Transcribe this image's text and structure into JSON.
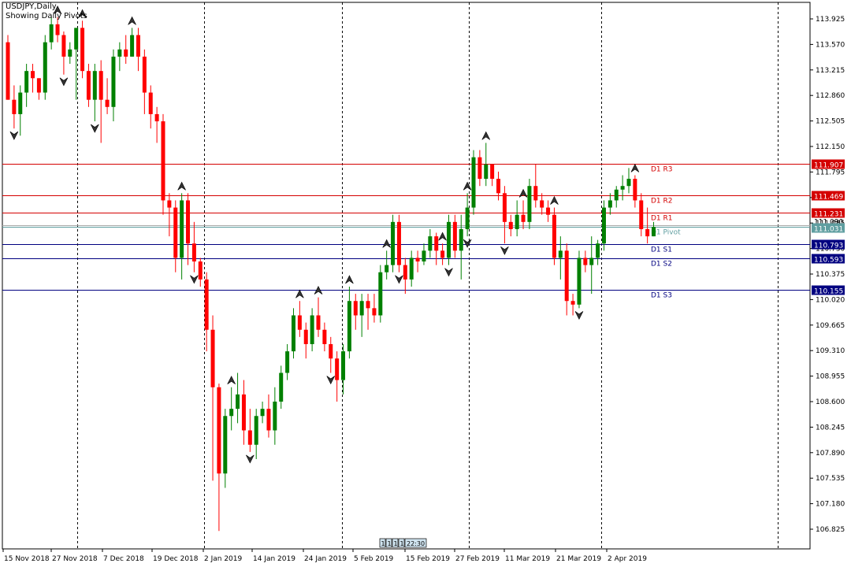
{
  "header": {
    "symbol_title": "USDJPY,Daily",
    "indicator_note": "Showing Daily Pivots"
  },
  "colors": {
    "bull": "#008000",
    "bear": "#ff0000",
    "resistance_line": "#d40000",
    "support_line": "#000080",
    "pivot_line": "#5f9ea0",
    "current_price_line": "#a9a9a9",
    "grid": "#000000",
    "background": "#ffffff"
  },
  "chart_data": {
    "type": "candlestick",
    "symbol": "USDJPY",
    "timeframe": "Daily",
    "ylim": [
      106.5,
      114.1
    ],
    "y_ticks": [
      "113.925",
      "113.570",
      "113.215",
      "112.860",
      "112.505",
      "112.150",
      "111.795",
      "111.440",
      "111.085",
      "110.730",
      "110.375",
      "110.020",
      "109.665",
      "109.310",
      "108.955",
      "108.600",
      "108.245",
      "107.890",
      "107.535",
      "107.180",
      "106.825"
    ],
    "x_tick_labels": [
      "15 Nov 2018",
      "27 Nov 2018",
      "7 Dec 2018",
      "19 Dec 2018",
      "2 Jan 2019",
      "14 Jan 2019",
      "24 Jan 2019",
      "5 Feb 2019",
      "15 Feb 2019",
      "27 Feb 2019",
      "11 Mar 2019",
      "21 Mar 2019",
      "2 Apr 2019"
    ],
    "grid": "vertical dashed separators",
    "candles": [
      {
        "o": 113.6,
        "h": 113.7,
        "l": 112.8,
        "c": 112.8
      },
      {
        "o": 112.8,
        "h": 113.0,
        "l": 112.4,
        "c": 112.6
      },
      {
        "o": 112.6,
        "h": 113.0,
        "l": 112.3,
        "c": 112.9
      },
      {
        "o": 112.9,
        "h": 113.3,
        "l": 112.7,
        "c": 113.2
      },
      {
        "o": 113.2,
        "h": 113.3,
        "l": 112.9,
        "c": 113.1
      },
      {
        "o": 113.1,
        "h": 113.1,
        "l": 112.8,
        "c": 112.9
      },
      {
        "o": 112.9,
        "h": 113.7,
        "l": 112.8,
        "c": 113.6
      },
      {
        "o": 113.6,
        "h": 113.95,
        "l": 113.5,
        "c": 113.85
      },
      {
        "o": 113.85,
        "h": 113.95,
        "l": 113.6,
        "c": 113.7
      },
      {
        "o": 113.7,
        "h": 113.75,
        "l": 113.15,
        "c": 113.4
      },
      {
        "o": 113.4,
        "h": 113.6,
        "l": 113.3,
        "c": 113.5
      },
      {
        "o": 113.5,
        "h": 113.8,
        "l": 112.8,
        "c": 113.8
      },
      {
        "o": 113.8,
        "h": 113.9,
        "l": 113.1,
        "c": 113.2
      },
      {
        "o": 113.2,
        "h": 113.3,
        "l": 112.7,
        "c": 112.8
      },
      {
        "o": 112.8,
        "h": 113.3,
        "l": 112.5,
        "c": 113.2
      },
      {
        "o": 113.2,
        "h": 113.35,
        "l": 112.2,
        "c": 112.8
      },
      {
        "o": 112.8,
        "h": 113.1,
        "l": 112.6,
        "c": 112.7
      },
      {
        "o": 112.7,
        "h": 113.5,
        "l": 112.5,
        "c": 113.4
      },
      {
        "o": 113.4,
        "h": 113.6,
        "l": 113.2,
        "c": 113.5
      },
      {
        "o": 113.5,
        "h": 113.7,
        "l": 113.3,
        "c": 113.4
      },
      {
        "o": 113.4,
        "h": 113.8,
        "l": 113.4,
        "c": 113.7
      },
      {
        "o": 113.7,
        "h": 113.8,
        "l": 113.2,
        "c": 113.4
      },
      {
        "o": 113.4,
        "h": 113.5,
        "l": 112.6,
        "c": 112.9
      },
      {
        "o": 112.9,
        "h": 113.0,
        "l": 112.4,
        "c": 112.6
      },
      {
        "o": 112.6,
        "h": 112.7,
        "l": 112.2,
        "c": 112.5
      },
      {
        "o": 112.5,
        "h": 112.6,
        "l": 111.2,
        "c": 111.4
      },
      {
        "o": 111.4,
        "h": 111.5,
        "l": 110.9,
        "c": 111.3
      },
      {
        "o": 111.3,
        "h": 111.4,
        "l": 110.4,
        "c": 110.6
      },
      {
        "o": 110.6,
        "h": 111.5,
        "l": 110.3,
        "c": 111.4
      },
      {
        "o": 111.4,
        "h": 111.5,
        "l": 110.5,
        "c": 110.8
      },
      {
        "o": 110.8,
        "h": 111.1,
        "l": 110.4,
        "c": 110.55
      },
      {
        "o": 110.55,
        "h": 110.6,
        "l": 110.2,
        "c": 110.3
      },
      {
        "o": 110.3,
        "h": 110.4,
        "l": 109.3,
        "c": 109.6
      },
      {
        "o": 109.6,
        "h": 109.8,
        "l": 107.5,
        "c": 108.8
      },
      {
        "o": 108.8,
        "h": 108.85,
        "l": 106.8,
        "c": 107.6
      },
      {
        "o": 107.6,
        "h": 108.5,
        "l": 107.4,
        "c": 108.4
      },
      {
        "o": 108.4,
        "h": 108.8,
        "l": 108.2,
        "c": 108.5
      },
      {
        "o": 108.5,
        "h": 109.0,
        "l": 108.3,
        "c": 108.7
      },
      {
        "o": 108.7,
        "h": 108.9,
        "l": 108.0,
        "c": 108.2
      },
      {
        "o": 108.2,
        "h": 108.5,
        "l": 107.9,
        "c": 108.0
      },
      {
        "o": 108.0,
        "h": 108.5,
        "l": 107.8,
        "c": 108.4
      },
      {
        "o": 108.4,
        "h": 108.6,
        "l": 108.3,
        "c": 108.5
      },
      {
        "o": 108.5,
        "h": 108.7,
        "l": 108.1,
        "c": 108.2
      },
      {
        "o": 108.2,
        "h": 108.8,
        "l": 108.0,
        "c": 108.6
      },
      {
        "o": 108.6,
        "h": 109.1,
        "l": 108.5,
        "c": 109.0
      },
      {
        "o": 109.0,
        "h": 109.4,
        "l": 108.9,
        "c": 109.3
      },
      {
        "o": 109.3,
        "h": 109.9,
        "l": 109.2,
        "c": 109.8
      },
      {
        "o": 109.8,
        "h": 110.0,
        "l": 109.5,
        "c": 109.6
      },
      {
        "o": 109.6,
        "h": 109.7,
        "l": 109.2,
        "c": 109.4
      },
      {
        "o": 109.4,
        "h": 109.9,
        "l": 109.3,
        "c": 109.8
      },
      {
        "o": 109.8,
        "h": 110.05,
        "l": 109.5,
        "c": 109.6
      },
      {
        "o": 109.6,
        "h": 109.7,
        "l": 109.3,
        "c": 109.4
      },
      {
        "o": 109.4,
        "h": 109.5,
        "l": 109.0,
        "c": 109.2
      },
      {
        "o": 109.2,
        "h": 109.3,
        "l": 108.6,
        "c": 108.9
      },
      {
        "o": 108.9,
        "h": 109.4,
        "l": 108.7,
        "c": 109.3
      },
      {
        "o": 109.3,
        "h": 110.2,
        "l": 109.2,
        "c": 110.0
      },
      {
        "o": 110.0,
        "h": 110.1,
        "l": 109.6,
        "c": 109.8
      },
      {
        "o": 109.8,
        "h": 110.1,
        "l": 109.5,
        "c": 110.0
      },
      {
        "o": 110.0,
        "h": 110.1,
        "l": 109.6,
        "c": 109.9
      },
      {
        "o": 109.9,
        "h": 110.1,
        "l": 109.7,
        "c": 109.8
      },
      {
        "o": 109.8,
        "h": 110.5,
        "l": 109.7,
        "c": 110.4
      },
      {
        "o": 110.4,
        "h": 110.7,
        "l": 110.3,
        "c": 110.5
      },
      {
        "o": 110.5,
        "h": 111.2,
        "l": 110.4,
        "c": 111.1
      },
      {
        "o": 111.1,
        "h": 111.2,
        "l": 110.4,
        "c": 110.5
      },
      {
        "o": 110.5,
        "h": 110.6,
        "l": 110.1,
        "c": 110.3
      },
      {
        "o": 110.3,
        "h": 110.7,
        "l": 110.2,
        "c": 110.6
      },
      {
        "o": 110.6,
        "h": 110.7,
        "l": 110.4,
        "c": 110.55
      },
      {
        "o": 110.55,
        "h": 110.8,
        "l": 110.5,
        "c": 110.7
      },
      {
        "o": 110.7,
        "h": 111.0,
        "l": 110.6,
        "c": 110.9
      },
      {
        "o": 110.9,
        "h": 110.95,
        "l": 110.5,
        "c": 110.7
      },
      {
        "o": 110.7,
        "h": 110.8,
        "l": 110.5,
        "c": 110.6
      },
      {
        "o": 110.6,
        "h": 111.2,
        "l": 110.5,
        "c": 111.1
      },
      {
        "o": 111.1,
        "h": 111.2,
        "l": 110.6,
        "c": 110.7
      },
      {
        "o": 110.7,
        "h": 111.2,
        "l": 110.3,
        "c": 111.0
      },
      {
        "o": 111.0,
        "h": 111.5,
        "l": 110.9,
        "c": 111.3
      },
      {
        "o": 111.3,
        "h": 112.1,
        "l": 111.2,
        "c": 112.0
      },
      {
        "o": 112.0,
        "h": 112.1,
        "l": 111.6,
        "c": 111.7
      },
      {
        "o": 111.7,
        "h": 112.2,
        "l": 111.6,
        "c": 111.9
      },
      {
        "o": 111.9,
        "h": 111.9,
        "l": 111.6,
        "c": 111.7
      },
      {
        "o": 111.7,
        "h": 111.8,
        "l": 111.4,
        "c": 111.5
      },
      {
        "o": 111.5,
        "h": 111.6,
        "l": 110.8,
        "c": 111.1
      },
      {
        "o": 111.1,
        "h": 111.2,
        "l": 110.9,
        "c": 111.0
      },
      {
        "o": 111.0,
        "h": 111.4,
        "l": 110.9,
        "c": 111.2
      },
      {
        "o": 111.2,
        "h": 111.4,
        "l": 111.0,
        "c": 111.1
      },
      {
        "o": 111.1,
        "h": 111.7,
        "l": 111.0,
        "c": 111.6
      },
      {
        "o": 111.6,
        "h": 111.9,
        "l": 111.3,
        "c": 111.4
      },
      {
        "o": 111.4,
        "h": 111.5,
        "l": 111.2,
        "c": 111.3
      },
      {
        "o": 111.3,
        "h": 111.4,
        "l": 111.1,
        "c": 111.2
      },
      {
        "o": 111.2,
        "h": 111.3,
        "l": 110.5,
        "c": 110.6
      },
      {
        "o": 110.6,
        "h": 110.9,
        "l": 110.3,
        "c": 110.7
      },
      {
        "o": 110.7,
        "h": 110.8,
        "l": 109.8,
        "c": 110.0
      },
      {
        "o": 110.0,
        "h": 110.1,
        "l": 109.8,
        "c": 109.95
      },
      {
        "o": 109.95,
        "h": 110.7,
        "l": 109.9,
        "c": 110.6
      },
      {
        "o": 110.6,
        "h": 110.7,
        "l": 110.4,
        "c": 110.5
      },
      {
        "o": 110.5,
        "h": 110.9,
        "l": 110.1,
        "c": 110.6
      },
      {
        "o": 110.6,
        "h": 110.85,
        "l": 110.5,
        "c": 110.8
      },
      {
        "o": 110.8,
        "h": 111.4,
        "l": 110.7,
        "c": 111.3
      },
      {
        "o": 111.3,
        "h": 111.5,
        "l": 111.2,
        "c": 111.4
      },
      {
        "o": 111.4,
        "h": 111.6,
        "l": 111.3,
        "c": 111.55
      },
      {
        "o": 111.55,
        "h": 111.75,
        "l": 111.4,
        "c": 111.6
      },
      {
        "o": 111.6,
        "h": 111.85,
        "l": 111.5,
        "c": 111.7
      },
      {
        "o": 111.7,
        "h": 111.75,
        "l": 111.3,
        "c": 111.4
      },
      {
        "o": 111.4,
        "h": 111.5,
        "l": 110.9,
        "c": 111.0
      },
      {
        "o": 111.0,
        "h": 111.3,
        "l": 110.8,
        "c": 110.9
      },
      {
        "o": 110.9,
        "h": 111.1,
        "l": 110.9,
        "c": 111.03
      }
    ],
    "fractals_up": [
      8,
      12,
      20,
      28,
      36,
      47,
      50,
      55,
      61,
      70,
      74,
      77,
      83,
      88,
      101
    ],
    "fractals_down": [
      1,
      9,
      14,
      30,
      39,
      52,
      63,
      71,
      74,
      80,
      92
    ],
    "pivot_levels": [
      {
        "name": "D1 R3",
        "value": "111.907",
        "kind": "resistance"
      },
      {
        "name": "D1 R2",
        "value": "111.469",
        "kind": "resistance"
      },
      {
        "name": "D1 R1",
        "value": "111.231",
        "kind": "resistance"
      },
      {
        "name": "D1 Pivot",
        "value": 111.031,
        "kind": "pivot"
      },
      {
        "name": "D1 S1",
        "value": "110.793",
        "kind": "support"
      },
      {
        "name": "D1 S2",
        "value": "110.593",
        "kind": "support"
      },
      {
        "name": "D1 S3",
        "value": "110.155",
        "kind": "support"
      }
    ],
    "current_price": "111.031",
    "current_price_overlap": "111.090",
    "x_marker_label": "22:30",
    "x_marker_boxes": [
      "1",
      "1",
      "1",
      "1"
    ]
  }
}
